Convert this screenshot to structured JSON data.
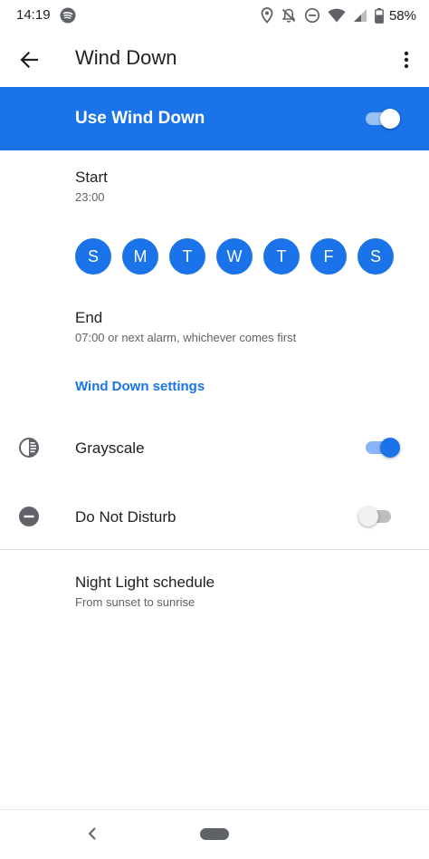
{
  "status_bar": {
    "time": "14:19",
    "battery_percent": "58%"
  },
  "app_bar": {
    "title": "Wind Down"
  },
  "master_switch": {
    "label": "Use Wind Down",
    "enabled": true
  },
  "start": {
    "title": "Start",
    "value": "23:00"
  },
  "days": [
    "S",
    "M",
    "T",
    "W",
    "T",
    "F",
    "S"
  ],
  "end": {
    "title": "End",
    "value": "07:00 or next alarm, whichever comes first"
  },
  "settings_link": "Wind Down settings",
  "grayscale": {
    "label": "Grayscale",
    "enabled": true,
    "icon": "grayscale-icon"
  },
  "dnd": {
    "label": "Do Not Disturb",
    "enabled": false,
    "icon": "do-not-disturb-icon"
  },
  "night_light": {
    "title": "Night Light schedule",
    "subtitle": "From sunset to sunrise",
    "icon": "moon-icon"
  },
  "colors": {
    "accent": "#1a73e8",
    "text_primary": "#202124",
    "text_secondary": "#5f6368"
  }
}
